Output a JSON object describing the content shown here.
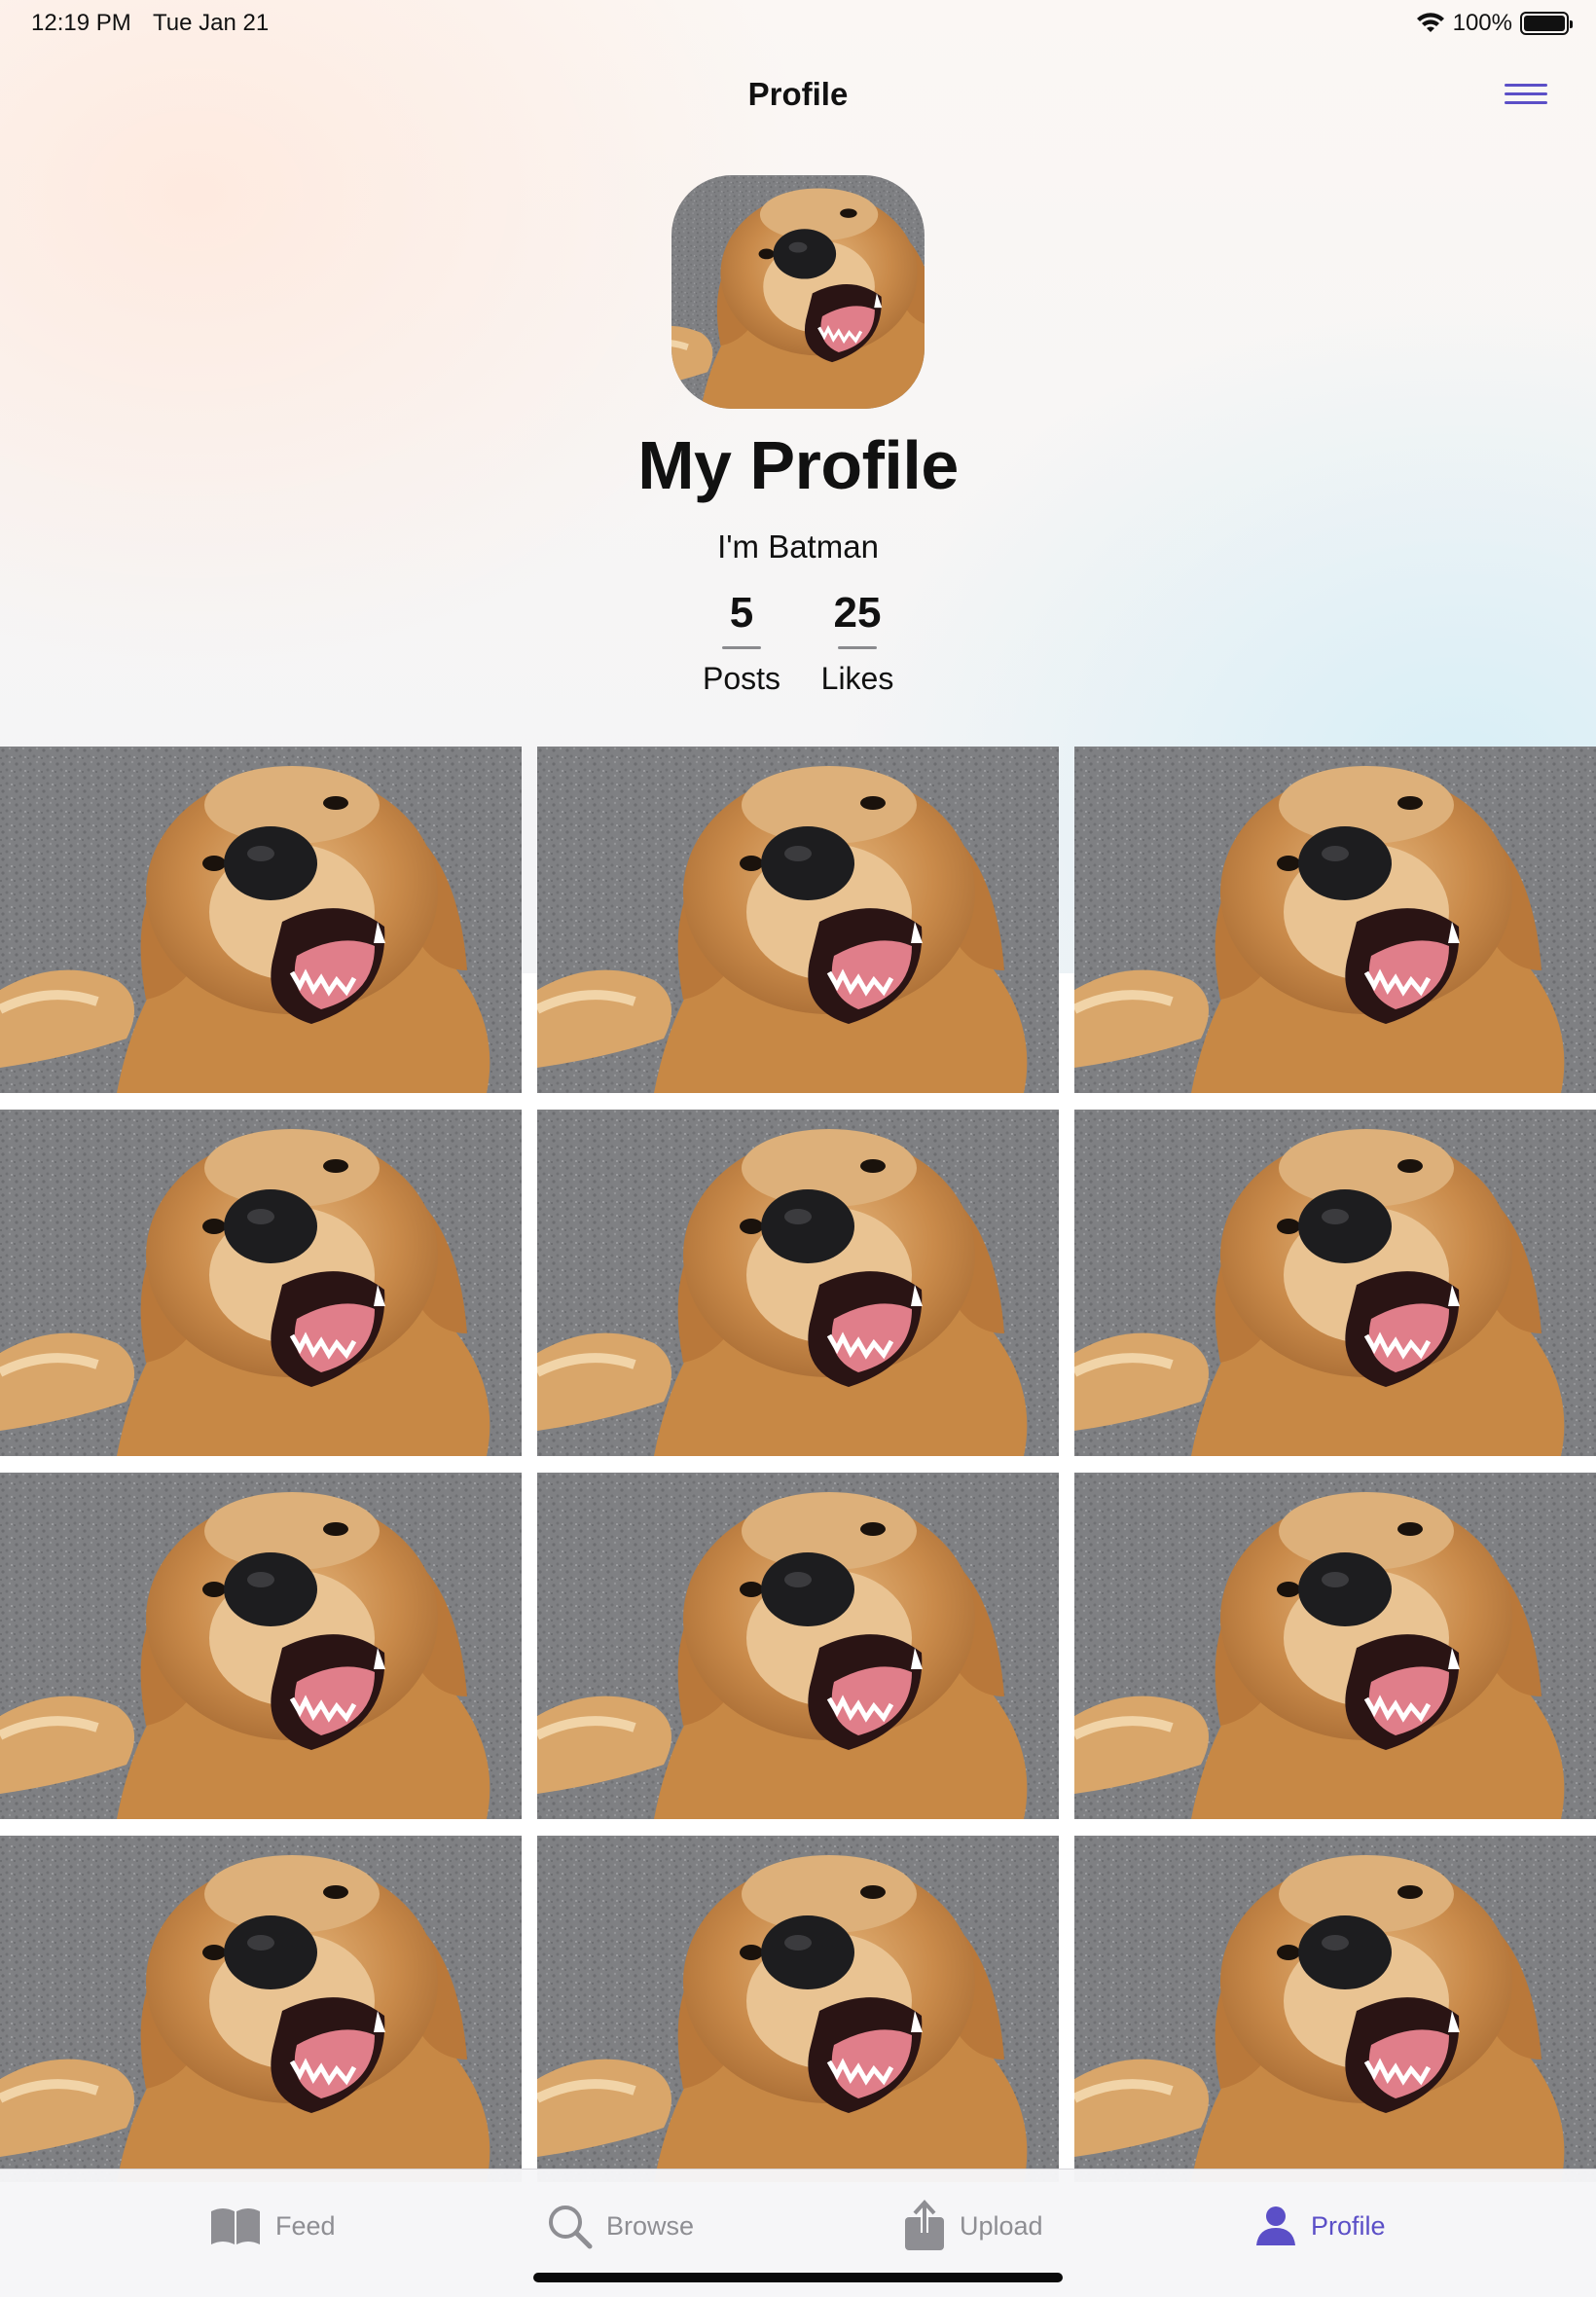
{
  "status_bar": {
    "time": "12:19 PM",
    "date": "Tue Jan 21",
    "battery": "100%"
  },
  "nav": {
    "title": "Profile",
    "menu_icon": "hamburger-menu-icon"
  },
  "profile": {
    "avatar_icon": "dog-photo",
    "name": "My Profile",
    "bio": "I'm Batman",
    "stats": [
      {
        "value": "5",
        "label": "Posts"
      },
      {
        "value": "25",
        "label": "Likes"
      }
    ]
  },
  "grid": {
    "columns": 3,
    "visible_tiles": 12,
    "tile_image": "golden-retriever-photo"
  },
  "tabbar": {
    "tabs": [
      {
        "label": "Feed",
        "icon": "book-icon",
        "active": false
      },
      {
        "label": "Browse",
        "icon": "search-icon",
        "active": false
      },
      {
        "label": "Upload",
        "icon": "upload-icon",
        "active": false
      },
      {
        "label": "Profile",
        "icon": "person-icon",
        "active": true
      }
    ]
  },
  "colors": {
    "accent": "#5b4fc7",
    "inactive": "#8e8e93"
  }
}
